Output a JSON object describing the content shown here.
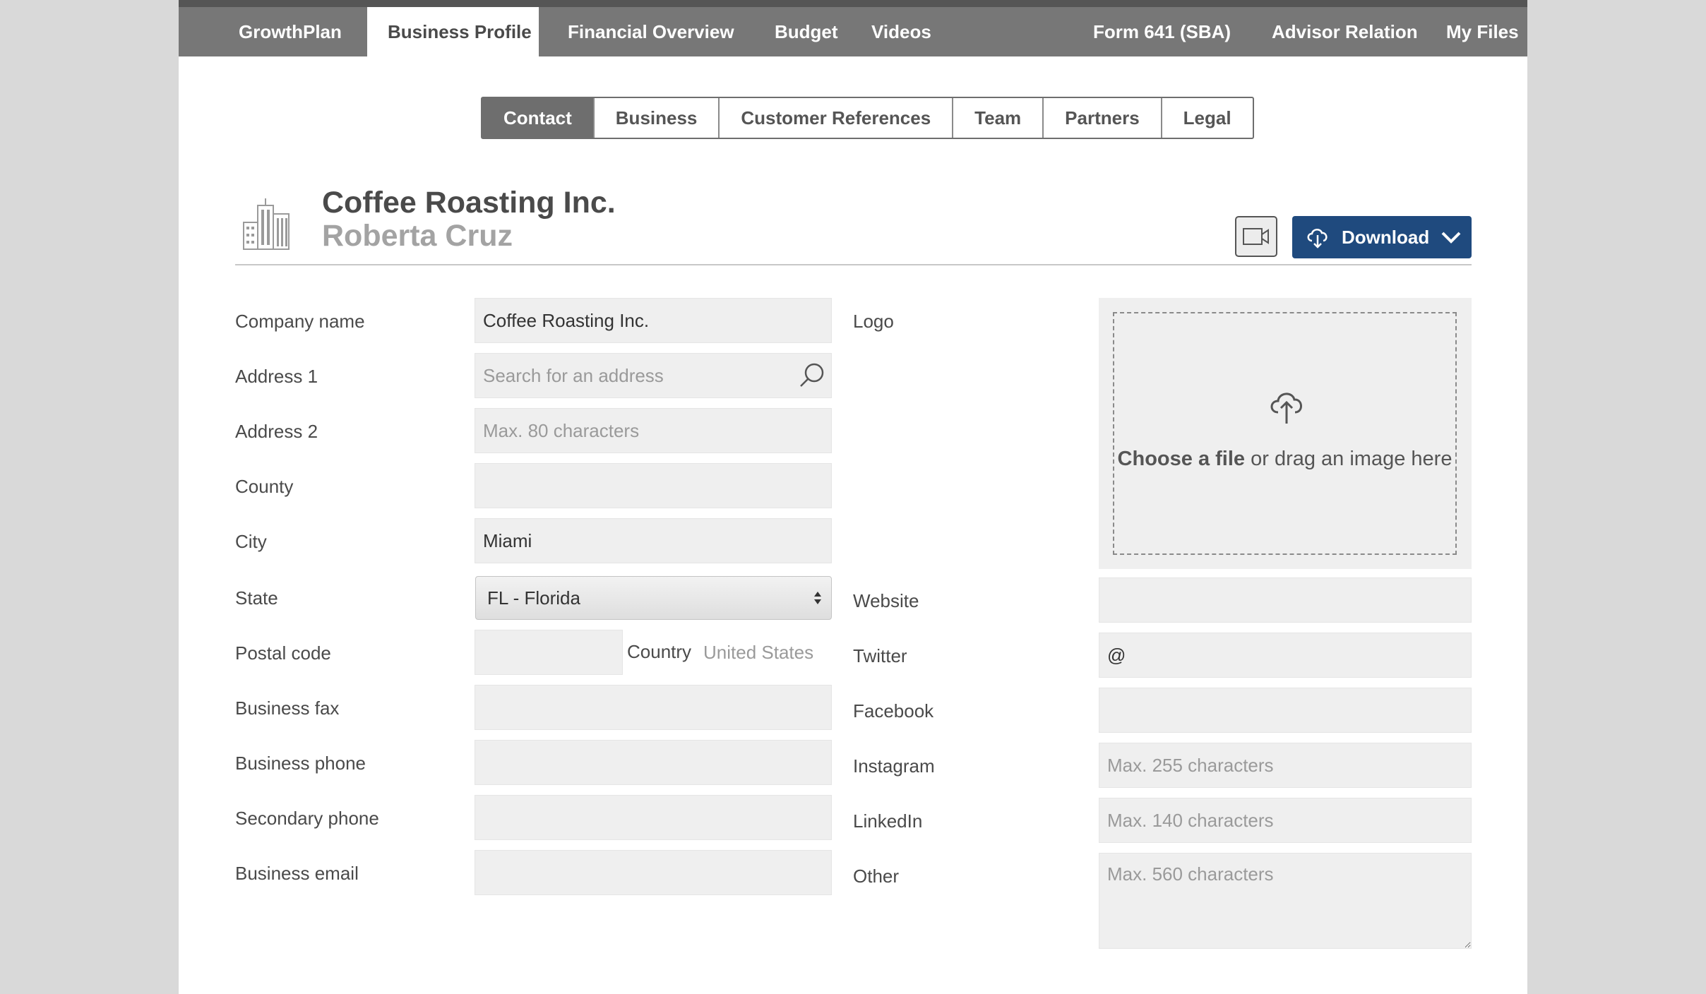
{
  "topnav": {
    "items": [
      {
        "label": "GrowthPlan"
      },
      {
        "label": "Business Profile"
      },
      {
        "label": "Financial Overview"
      },
      {
        "label": "Budget"
      },
      {
        "label": "Videos"
      },
      {
        "label": "Form 641 (SBA)"
      },
      {
        "label": "Advisor Relation"
      },
      {
        "label": "My Files"
      }
    ],
    "active": "Business Profile"
  },
  "subtabs": {
    "items": [
      {
        "label": "Contact"
      },
      {
        "label": "Business"
      },
      {
        "label": "Customer References"
      },
      {
        "label": "Team"
      },
      {
        "label": "Partners"
      },
      {
        "label": "Legal"
      }
    ],
    "active": "Contact"
  },
  "header": {
    "company": "Coffee Roasting Inc.",
    "person": "Roberta Cruz",
    "download_label": "Download"
  },
  "form": {
    "company_name": {
      "label": "Company name",
      "value": "Coffee Roasting Inc."
    },
    "address1": {
      "label": "Address 1",
      "placeholder": "Search for an address"
    },
    "address2": {
      "label": "Address 2",
      "placeholder": "Max. 80 characters"
    },
    "county": {
      "label": "County",
      "value": ""
    },
    "city": {
      "label": "City",
      "value": "Miami"
    },
    "state": {
      "label": "State",
      "value": "FL - Florida"
    },
    "postal_code": {
      "label": "Postal code",
      "value": ""
    },
    "country": {
      "label": "Country",
      "value": "United States"
    },
    "business_fax": {
      "label": "Business fax",
      "value": ""
    },
    "business_phone": {
      "label": "Business phone",
      "value": ""
    },
    "secondary_phone": {
      "label": "Secondary phone",
      "value": ""
    },
    "business_email": {
      "label": "Business email",
      "value": ""
    },
    "logo": {
      "label": "Logo",
      "choose": "Choose a file",
      "rest": " or drag an image here"
    },
    "website": {
      "label": "Website",
      "value": ""
    },
    "twitter": {
      "label": "Twitter",
      "value": "@"
    },
    "facebook": {
      "label": "Facebook",
      "value": ""
    },
    "instagram": {
      "label": "Instagram",
      "placeholder": "Max. 255 characters"
    },
    "linkedin": {
      "label": "LinkedIn",
      "placeholder": "Max. 140 characters"
    },
    "other": {
      "label": "Other",
      "placeholder": "Max. 560 characters"
    }
  },
  "colors": {
    "nav_bg": "#777777",
    "accent": "#1f4a7e",
    "field_bg": "#efefef"
  }
}
